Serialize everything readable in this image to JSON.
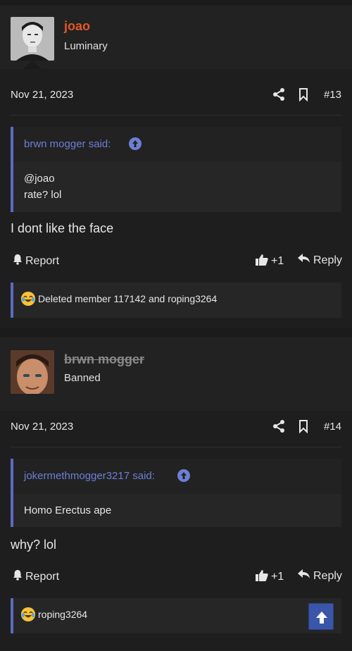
{
  "posts": [
    {
      "username": "joao",
      "user_title": "Luminary",
      "date": "Nov 21, 2023",
      "post_number": "#13",
      "quote_author": "brwn mogger said:",
      "quote_lines": [
        "@joao",
        "rate? lol"
      ],
      "text": "I dont like the face",
      "report_label": "Report",
      "like_count": "+1",
      "reply_label": "Reply",
      "reactions_text": "Deleted member 117142 and roping3264"
    },
    {
      "username": "brwn mogger",
      "user_title": "Banned",
      "date": "Nov 21, 2023",
      "post_number": "#14",
      "quote_author": "jokermethmogger3217 said:",
      "quote_lines": [
        "Homo Erectus ape"
      ],
      "text": "why? lol",
      "report_label": "Report",
      "like_count": "+1",
      "reply_label": "Reply",
      "reactions_text": "roping3264"
    }
  ],
  "colors": {
    "username_active": "#e2582a",
    "username_banned": "#8a8a8a",
    "accent": "#5b6bc0",
    "quote_link": "#6d7fd4"
  },
  "icons": {
    "share": "share-icon",
    "bookmark": "bookmark-icon",
    "report": "bell-icon",
    "like": "thumbs-up-icon",
    "reply": "reply-arrow-icon",
    "reaction": "crying-laughing-emoji-icon",
    "scroll": "arrow-up-icon"
  }
}
